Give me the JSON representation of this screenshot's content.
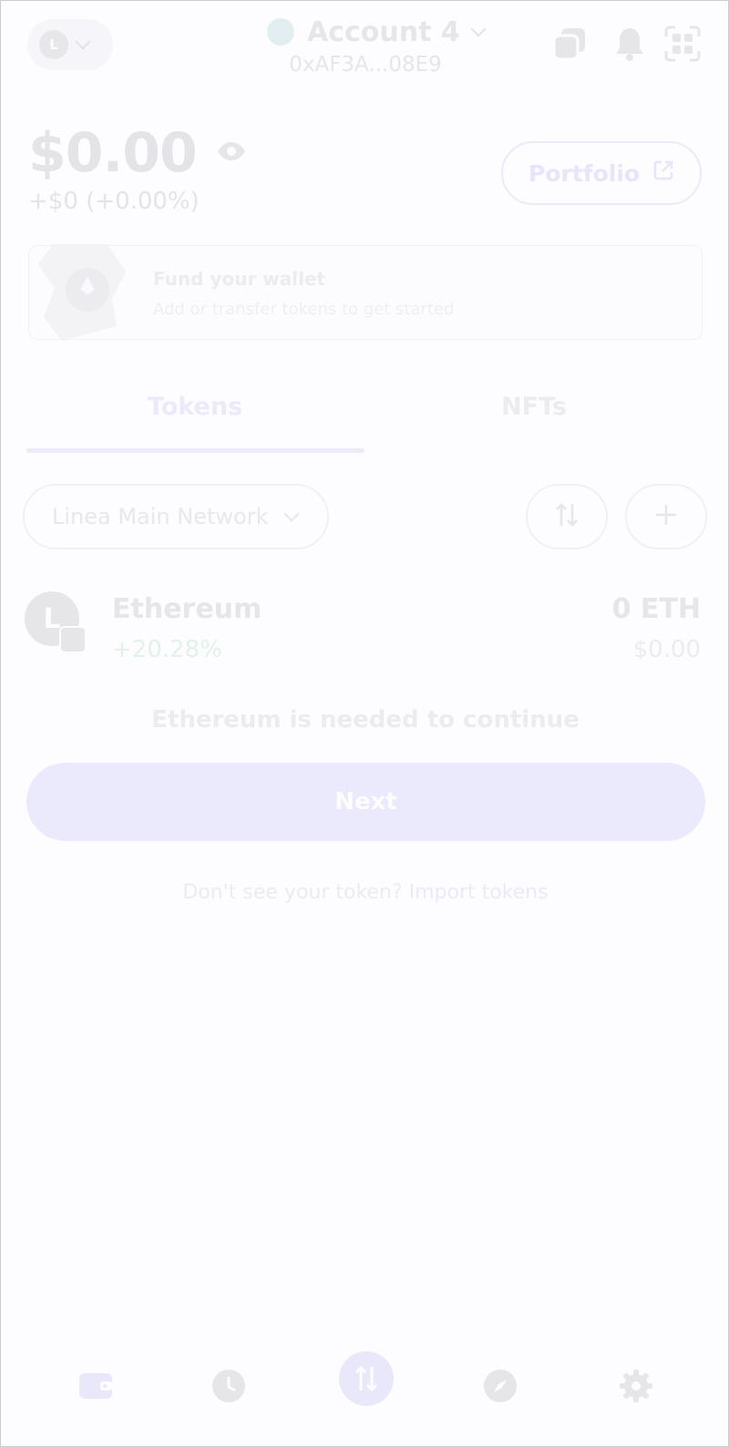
{
  "header": {
    "network_avatar_letter": "L",
    "account_name": "Account 4",
    "account_address": "0xAF3A...08E9",
    "icons": [
      "network-chevron-down-icon",
      "account-chevron-down-icon",
      "copy-icon",
      "bell-icon",
      "qr-scan-icon"
    ]
  },
  "balance": {
    "amount": "$0.00",
    "change": "+$0 (+0.00%)",
    "portfolio_label": "Portfolio",
    "icons": [
      "eye-icon",
      "external-link-icon"
    ]
  },
  "fund_card": {
    "title": "Fund your wallet",
    "subtitle": "Add or transfer tokens to get started"
  },
  "tabs": [
    {
      "label": "Tokens",
      "active": true
    },
    {
      "label": "NFTs",
      "active": false
    }
  ],
  "filter": {
    "network_label": "Linea Main Network",
    "icons": [
      "chevron-down-icon",
      "sort-icon",
      "add-icon"
    ]
  },
  "token": {
    "name": "Ethereum",
    "change": "+20.28%",
    "balance": "0 ETH",
    "fiat": "$0.00",
    "avatar_letter": "L"
  },
  "notice": {
    "message": "Ethereum is needed to continue",
    "next_label": "Next",
    "import_question": "Don't see your token?",
    "import_link": "Import tokens"
  },
  "bottom_nav": {
    "items": [
      "wallet-icon",
      "activity-icon",
      "swap-icon",
      "explore-icon",
      "settings-icon"
    ]
  },
  "colors": {
    "accent_faded": "#ebeafa",
    "text_faded": "#e6e6ea",
    "background": "#fdfcff"
  }
}
